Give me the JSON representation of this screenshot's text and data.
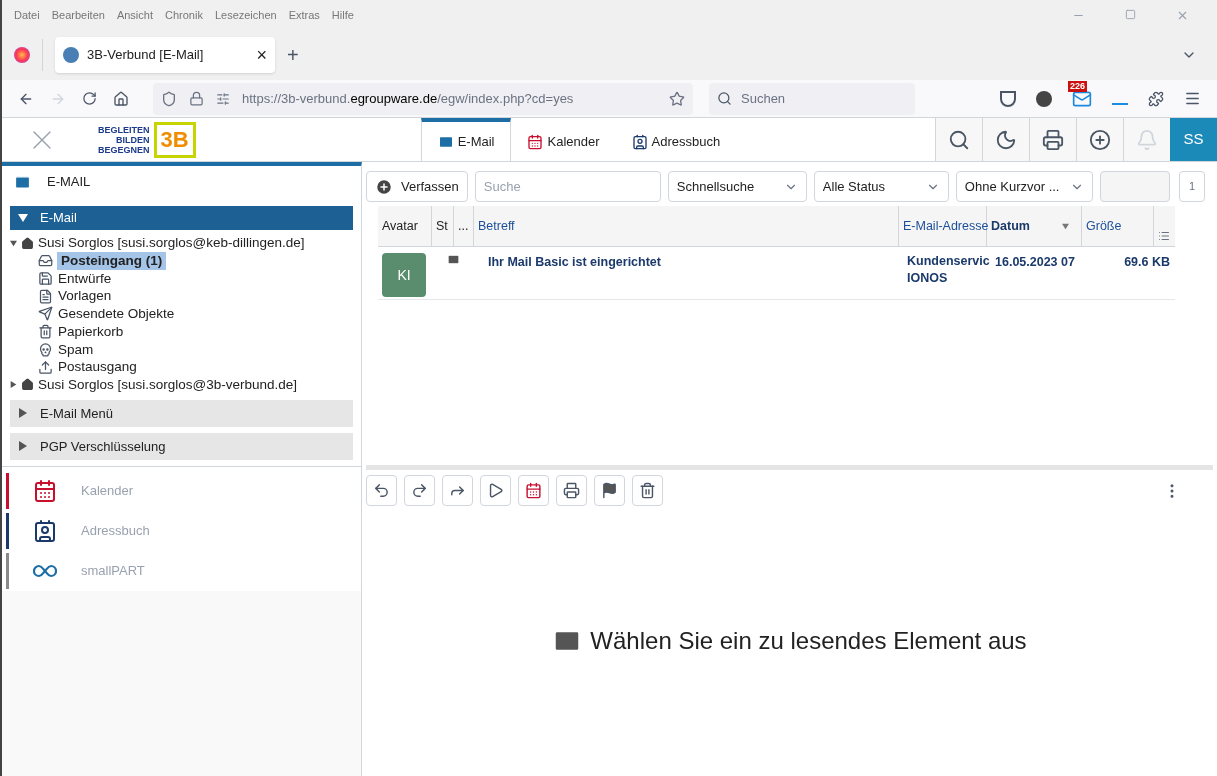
{
  "browser": {
    "menu": [
      "Datei",
      "Bearbeiten",
      "Ansicht",
      "Chronik",
      "Lesezeichen",
      "Extras",
      "Hilfe"
    ],
    "tab": {
      "title": "3B-Verbund [E-Mail]",
      "close": "×"
    },
    "new_tab": "+",
    "url": {
      "prefix": "https://3b-verbund.",
      "domain": "egroupware.de",
      "path": "/egw/index.php?cd=yes"
    },
    "search": {
      "placeholder": "Suchen"
    },
    "mail_badge": "226"
  },
  "header": {
    "logo_lines": [
      "BEGLEITEN",
      "BILDEN",
      "BEGEGNEN"
    ],
    "logo_mark": "3B",
    "avatar": "SS",
    "tabs": [
      {
        "label": "E-Mail",
        "selected": true,
        "kind": "mail"
      },
      {
        "label": "Kalender",
        "selected": false,
        "kind": "calendar"
      },
      {
        "label": "Adressbuch",
        "selected": false,
        "kind": "contacts"
      }
    ]
  },
  "sidebar": {
    "title": "E-MAIL",
    "section": {
      "label": "E-Mail",
      "expanded": true
    },
    "accounts": [
      {
        "label": "Susi Sorglos [susi.sorglos@keb-dillingen.de]",
        "expanded": true,
        "children": [
          {
            "label": "Posteingang (1)",
            "kind": "inbox",
            "selected": true
          },
          {
            "label": "Entwürfe",
            "kind": "drafts",
            "selected": false
          },
          {
            "label": "Vorlagen",
            "kind": "templates",
            "selected": false
          },
          {
            "label": "Gesendete Objekte",
            "kind": "sent",
            "selected": false
          },
          {
            "label": "Papierkorb",
            "kind": "trash",
            "selected": false
          },
          {
            "label": "Spam",
            "kind": "spam",
            "selected": false
          },
          {
            "label": "Postausgang",
            "kind": "outbox",
            "selected": false
          }
        ]
      },
      {
        "label": "Susi Sorglos [susi.sorglos@3b-verbund.de]",
        "expanded": false
      }
    ],
    "panels": [
      {
        "label": "E-Mail Menü",
        "expanded": false
      },
      {
        "label": "PGP Verschlüsselung",
        "expanded": false
      }
    ],
    "apps": [
      {
        "label": "Kalender",
        "kind": "calendar",
        "color": "#c8102e"
      },
      {
        "label": "Adressbuch",
        "kind": "contacts",
        "color": "#1b3a6b"
      },
      {
        "label": "smallPART",
        "kind": "smallpart",
        "color": "#8a8a8a"
      }
    ]
  },
  "toolbar": {
    "compose": "Verfassen",
    "search": {
      "placeholder": "Suche"
    },
    "filters": [
      "Schnellsuche",
      "Alle Status",
      "Ohne Kurzvor ..."
    ],
    "page": "1"
  },
  "table": {
    "columns": [
      {
        "label": "Avatar",
        "kind": "plain"
      },
      {
        "label": "St",
        "kind": "plain"
      },
      {
        "label": "...",
        "kind": "plain"
      },
      {
        "label": "Betreff",
        "kind": "link"
      },
      {
        "label": "E-Mail-Adresse",
        "kind": "link"
      },
      {
        "label": "Datum",
        "kind": "sorted"
      },
      {
        "label": "Größe",
        "kind": "link"
      }
    ],
    "rows": [
      {
        "avatar": "KI",
        "subject": "Ihr Mail Basic ist eingerichtet",
        "address": [
          "Kundenservic",
          "IONOS"
        ],
        "date": "16.05.2023 07",
        "size": "69.6 KB",
        "unread": true
      }
    ]
  },
  "preview": {
    "message": "Wählen Sie ein zu lesendes Element aus"
  }
}
